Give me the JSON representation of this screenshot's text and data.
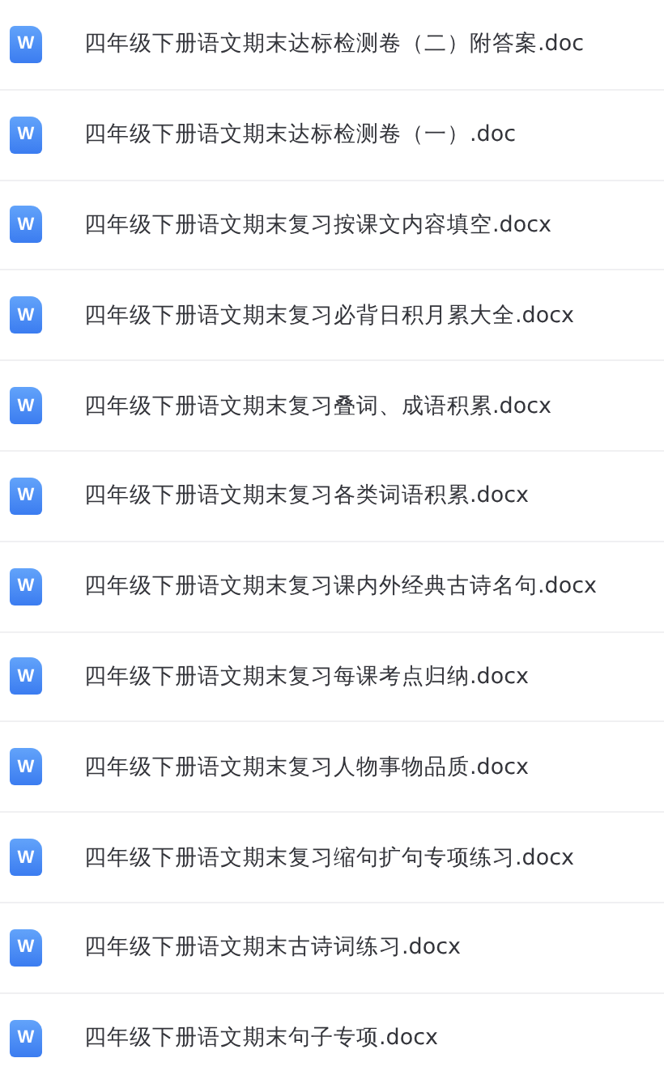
{
  "files": [
    {
      "icon": "W",
      "name": "四年级下册语文期末达标检测卷（二）附答案.doc"
    },
    {
      "icon": "W",
      "name": "四年级下册语文期末达标检测卷（一）.doc"
    },
    {
      "icon": "W",
      "name": "四年级下册语文期末复习按课文内容填空.docx"
    },
    {
      "icon": "W",
      "name": "四年级下册语文期末复习必背日积月累大全.docx"
    },
    {
      "icon": "W",
      "name": "四年级下册语文期末复习叠词、成语积累.docx"
    },
    {
      "icon": "W",
      "name": "四年级下册语文期末复习各类词语积累.docx"
    },
    {
      "icon": "W",
      "name": "四年级下册语文期末复习课内外经典古诗名句.docx"
    },
    {
      "icon": "W",
      "name": "四年级下册语文期末复习每课考点归纳.docx"
    },
    {
      "icon": "W",
      "name": "四年级下册语文期末复习人物事物品质.docx"
    },
    {
      "icon": "W",
      "name": "四年级下册语文期末复习缩句扩句专项练习.docx"
    },
    {
      "icon": "W",
      "name": "四年级下册语文期末古诗词练习.docx"
    },
    {
      "icon": "W",
      "name": "四年级下册语文期末句子专项.docx"
    }
  ]
}
